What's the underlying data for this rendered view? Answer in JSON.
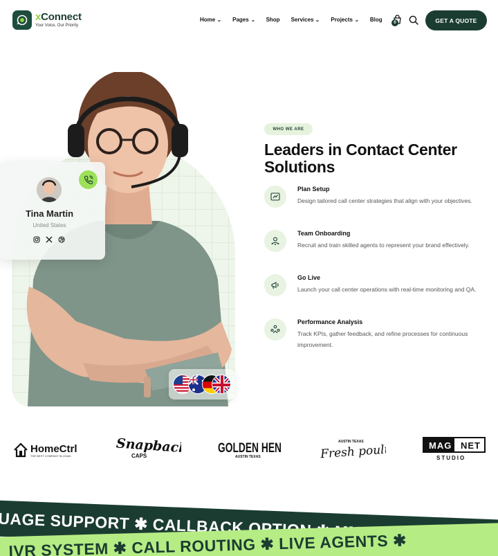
{
  "brand": {
    "name_prefix": "x",
    "name": "Connect",
    "tagline": "Your Voice, Our Priority"
  },
  "nav": {
    "items": [
      {
        "label": "Home",
        "dropdown": true
      },
      {
        "label": "Pages",
        "dropdown": true
      },
      {
        "label": "Shop",
        "dropdown": false
      },
      {
        "label": "Services",
        "dropdown": true
      },
      {
        "label": "Projects",
        "dropdown": true
      },
      {
        "label": "Blog",
        "dropdown": false
      }
    ],
    "cart_count": "0",
    "cta_label": "GET A QUOTE"
  },
  "profile": {
    "name": "Tina Martin",
    "location": "United States",
    "socials": [
      "instagram-icon",
      "x-icon",
      "dribbble-icon"
    ]
  },
  "flags": [
    "us-flag",
    "australia-flag",
    "germany-flag",
    "uk-flag"
  ],
  "about": {
    "tag": "WHO WE ARE",
    "heading_line1": "Leaders in Contact Center",
    "heading_line2": "Solutions",
    "steps": [
      {
        "icon": "plan-icon",
        "title": "Plan Setup",
        "desc": "Design tailored call center strategies that align with your objectives."
      },
      {
        "icon": "team-icon",
        "title": "Team Onboarding",
        "desc": "Recruit and train skilled agents to represent your brand effectively."
      },
      {
        "icon": "megaphone-icon",
        "title": "Go Live",
        "desc": "Launch your call center operations with real-time monitoring and QA."
      },
      {
        "icon": "analytics-icon",
        "title": "Performance Analysis",
        "desc": "Track KPIs, gather feedback, and refine processes for continuous improvement."
      }
    ]
  },
  "brands": {
    "homectrl": {
      "name": "HomeCtrl",
      "slogan": "THE BEST COMPANY SLOGAN"
    },
    "snapback": {
      "name": "Snapback",
      "sub": "CAPS"
    },
    "goldenhen": {
      "name": "GOLDEN HEN",
      "sub": "AUSTIN TEXAS"
    },
    "freshpoultry": {
      "top": "AUSTIN TEXAS",
      "name": "Fresh poultry"
    },
    "magnet": {
      "left": "MAG",
      "right": "NET",
      "sub": "STUDIO"
    }
  },
  "ticker": {
    "dark": "GUAGE SUPPORT  ✱  CALLBACK OPTION  ✱  MMULTICHANNEL SU",
    "light": "IVR SYSTEM  ✱  CALL ROUTING  ✱  LIVE AGENTS  ✱"
  }
}
